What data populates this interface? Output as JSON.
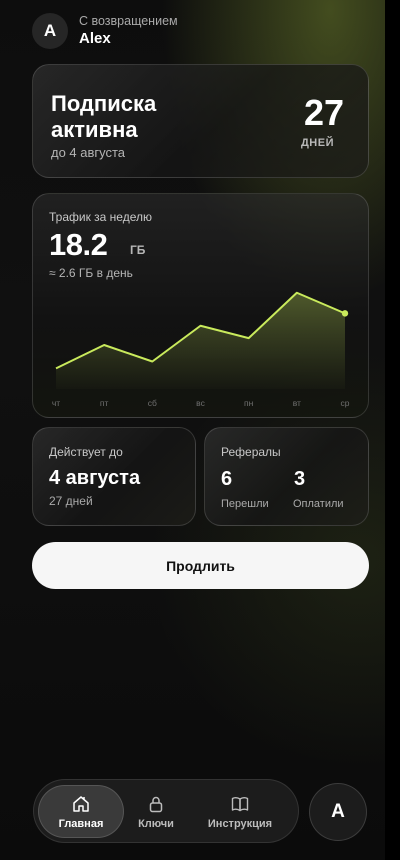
{
  "header": {
    "avatar_letter": "A",
    "greeting": "С возвращением",
    "username": "Alex"
  },
  "subscription": {
    "title": "Подписка активна",
    "until": "до 4 августа",
    "days_value": "27",
    "days_label": "ДНЕЙ"
  },
  "traffic": {
    "title": "Трафик за неделю",
    "value": "18.2",
    "unit": "ГБ",
    "daily": "≈ 2.6 ГБ в день"
  },
  "chart_data": {
    "type": "area",
    "categories": [
      "чт",
      "пт",
      "сб",
      "вс",
      "пн",
      "вт",
      "ср"
    ],
    "values": [
      1.5,
      3.2,
      2.0,
      4.6,
      3.7,
      7.0,
      5.5
    ],
    "ylim": [
      0,
      8
    ],
    "line_color": "#c9ea5c",
    "grid": false
  },
  "valid": {
    "title": "Действует до",
    "date": "4 августа",
    "days": "27 дней"
  },
  "referrals": {
    "title": "Рефералы",
    "joined_value": "6",
    "joined_label": "Перешли",
    "paid_value": "3",
    "paid_label": "Оплатили"
  },
  "extend_button": {
    "label": "Продлить"
  },
  "nav": {
    "items": [
      {
        "label": "Главная",
        "icon": "home-icon",
        "active": true
      },
      {
        "label": "Ключи",
        "icon": "lock-icon",
        "active": false
      },
      {
        "label": "Инструкция",
        "icon": "book-icon",
        "active": false
      }
    ],
    "profile_letter": "A"
  },
  "colors": {
    "accent": "#c9ea5c",
    "button_bg": "#f6f6f6"
  }
}
